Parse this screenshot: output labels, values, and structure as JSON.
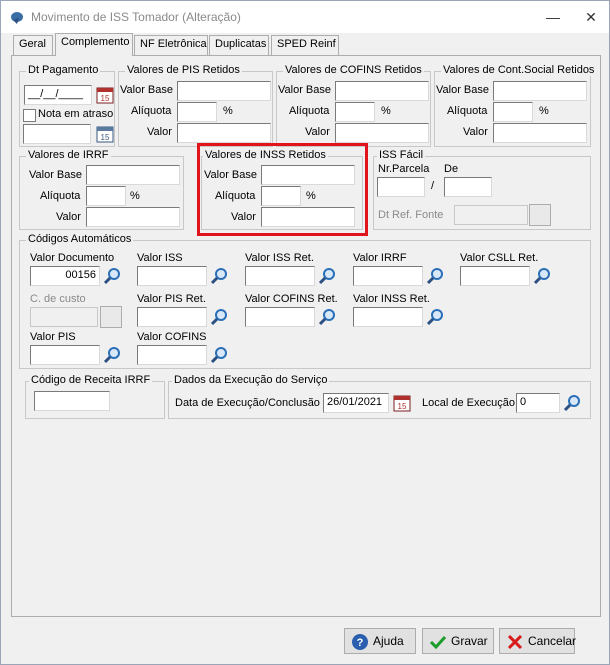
{
  "window": {
    "title": "Movimento de ISS Tomador (Alteração)"
  },
  "tabs": [
    "Geral",
    "Complemento",
    "NF Eletrônica",
    "Duplicatas",
    "SPED Reinf"
  ],
  "dt_pagamento": {
    "legend": "Dt Pagamento",
    "value": "__/__/____",
    "nota_label": "Nota em atraso",
    "nota_value": ""
  },
  "pis": {
    "legend": "Valores de PIS Retidos",
    "base_label": "Valor Base",
    "aliquota_label": "Alíquota",
    "pct": "%",
    "valor_label": "Valor"
  },
  "cofins": {
    "legend": "Valores de COFINS Retidos",
    "base_label": "Valor Base",
    "aliquota_label": "Alíquota",
    "pct": "%",
    "valor_label": "Valor"
  },
  "csll": {
    "legend": "Valores de Cont.Social Retidos",
    "base_label": "Valor Base",
    "aliquota_label": "Alíquota",
    "pct": "%",
    "valor_label": "Valor"
  },
  "irrf": {
    "legend": "Valores de IRRF",
    "base_label": "Valor Base",
    "aliquota_label": "Alíquota",
    "pct": "%",
    "valor_label": "Valor"
  },
  "inss": {
    "legend": "Valores de INSS Retidos",
    "base_label": "Valor Base",
    "aliquota_label": "Alíquota",
    "pct": "%",
    "valor_label": "Valor"
  },
  "iss_facil": {
    "legend": "ISS Fácil",
    "nr_parcela_label": "Nr.Parcela",
    "de_label": "De",
    "slash": "/",
    "dt_ref_label": "Dt Ref. Fonte"
  },
  "codigos": {
    "legend": "Códigos Automáticos",
    "valor_documento_label": "Valor Documento",
    "valor_documento_value": "00156",
    "valor_iss_label": "Valor ISS",
    "valor_iss_ret_label": "Valor ISS Ret.",
    "valor_irrf_label": "Valor IRRF",
    "valor_csll_ret_label": "Valor CSLL Ret.",
    "c_custo_label": "C. de custo",
    "valor_pis_ret_label": "Valor PIS Ret.",
    "valor_cofins_ret_label": "Valor COFINS Ret.",
    "valor_inss_ret_label": "Valor INSS Ret.",
    "valor_pis_label": "Valor PIS",
    "valor_cofins_label": "Valor COFINS"
  },
  "receita": {
    "legend": "Código de Receita IRRF"
  },
  "execucao": {
    "legend": "Dados da Execução do Serviço",
    "data_label": "Data de Execução/Conclusão",
    "data_value": "26/01/2021",
    "local_label": "Local de Execução",
    "local_value": "0"
  },
  "buttons": {
    "ajuda": "Ajuda",
    "gravar": "Gravar",
    "cancelar": "Cancelar"
  },
  "colors": {
    "highlight": "#e1141e",
    "magnifier": "#2a6fb8",
    "ok": "#1a9b2a",
    "cancel": "#d81a1a"
  }
}
